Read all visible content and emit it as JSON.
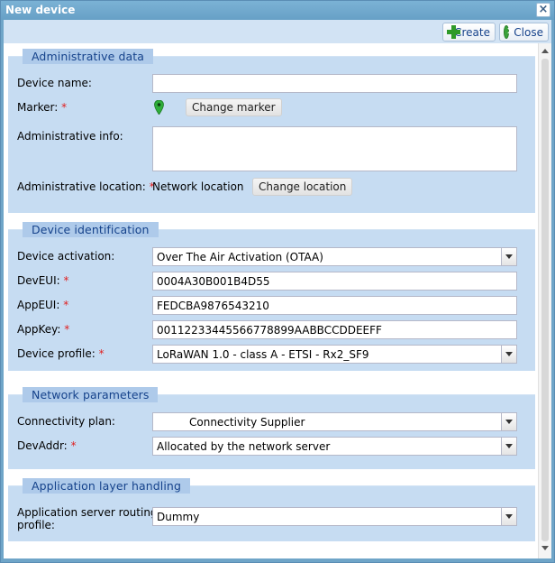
{
  "window": {
    "title": "New device",
    "close_glyph": "×"
  },
  "toolbar": {
    "create_label": "Create",
    "close_label": "Close"
  },
  "admin": {
    "header": "Administrative data",
    "device_name_label": "Device name:",
    "device_name_value": "",
    "marker_label": "Marker:",
    "change_marker_label": "Change marker",
    "admin_info_label": "Administrative info:",
    "admin_info_value": "",
    "admin_location_label": "Administrative location:",
    "admin_location_value": "Network location",
    "change_location_label": "Change location"
  },
  "identification": {
    "header": "Device identification",
    "activation_label": "Device activation:",
    "activation_value": "Over The Air Activation (OTAA)",
    "deveui_label": "DevEUI:",
    "deveui_value": "0004A30B001B4D55",
    "appeui_label": "AppEUI:",
    "appeui_value": "FEDCBA9876543210",
    "appkey_label": "AppKey:",
    "appkey_value": "00112233445566778899AABBCCDDEEFF",
    "profile_label": "Device profile:",
    "profile_value": "LoRaWAN 1.0 - class A - ETSI - Rx2_SF9"
  },
  "network": {
    "header": "Network parameters",
    "connectivity_label": "Connectivity plan:",
    "connectivity_value": "Connectivity Supplier",
    "devaddr_label": "DevAddr:",
    "devaddr_value": "Allocated by the network server"
  },
  "application": {
    "header": "Application layer handling",
    "routing_label_line1": "Application server routing",
    "routing_label_line2": "profile:",
    "routing_value": "Dummy"
  },
  "required_mark": "*",
  "colors": {
    "window_blue": "#6fa5c8",
    "panel_blue": "#c6dcf2",
    "header_blue": "#aecaea",
    "required_red": "#e02020",
    "marker_green": "#2fae3a"
  },
  "icons": {
    "create": "plus-icon",
    "close": "cancel-icon",
    "marker": "map-pin-icon"
  }
}
